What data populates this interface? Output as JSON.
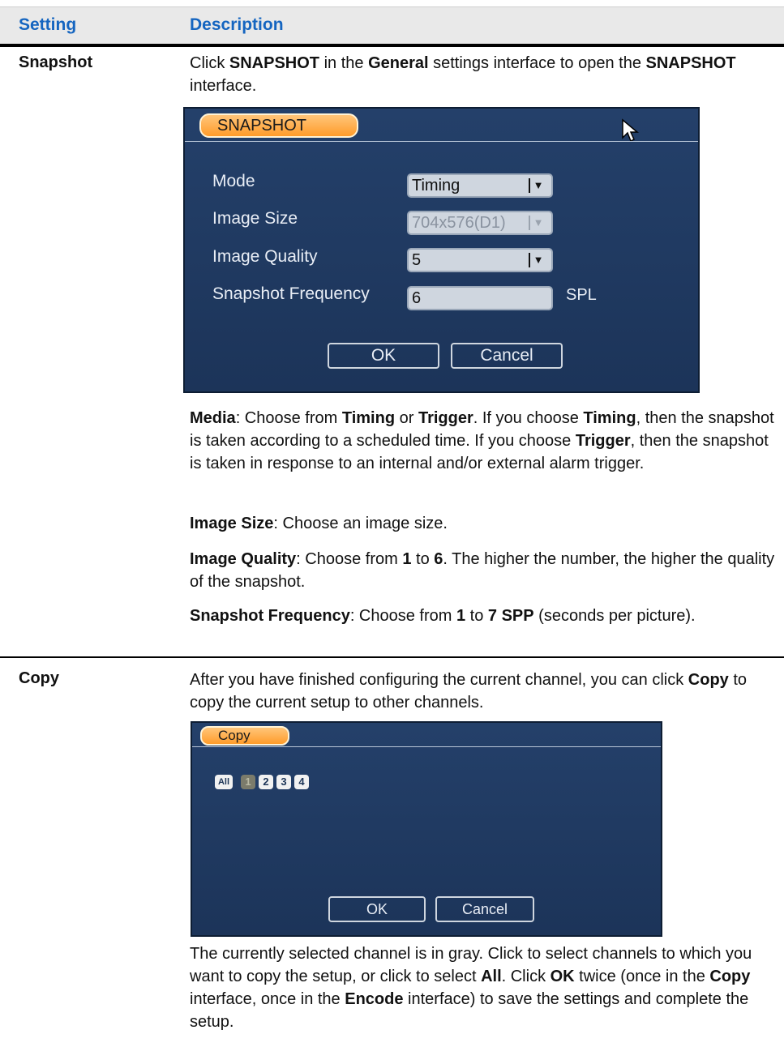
{
  "header": {
    "setting": "Setting",
    "description": "Description"
  },
  "snapshot": {
    "label": "Snapshot",
    "intro": [
      "Click ",
      "SNAPSHOT",
      " in the ",
      "General",
      " settings interface to open the ",
      "SNAPSHOT",
      " interface."
    ],
    "dialog": {
      "title": "SNAPSHOT",
      "mode_label": "Mode",
      "mode_value": "Timing",
      "size_label": "Image Size",
      "size_value": "704x576(D1)",
      "quality_label": "Image Quality",
      "quality_value": "5",
      "freq_label": "Snapshot Frequency",
      "freq_value": "6",
      "freq_unit": "SPL",
      "ok": "OK",
      "cancel": "Cancel"
    },
    "media": [
      "Media",
      ": Choose from ",
      "Timing",
      " or ",
      "Trigger",
      ". If you choose ",
      "Timing",
      ", then the snapshot is taken according to a scheduled time. If you choose ",
      "Trigger",
      ", then the snapshot is taken in response to an internal and/or external alarm trigger."
    ],
    "image_size": [
      "Image Size",
      ": Choose an image size."
    ],
    "image_quality": [
      "Image Quality",
      ": Choose from ",
      "1",
      " to ",
      "6",
      ". The higher the number, the higher the quality of the snapshot."
    ],
    "snapshot_frequency": [
      "Snapshot Frequency",
      ": Choose from ",
      "1",
      " to ",
      "7 SPP",
      " (seconds per picture)."
    ]
  },
  "copy": {
    "label": "Copy",
    "intro": [
      "After you have finished configuring the current channel, you can click ",
      "Copy",
      " to copy the current setup to other channels."
    ],
    "dialog": {
      "title": "Copy",
      "all": "All",
      "channels": [
        "1",
        "2",
        "3",
        "4"
      ],
      "selected_channel": "1",
      "ok": "OK",
      "cancel": "Cancel"
    },
    "outro": [
      "The currently selected channel is in gray. Click to select channels to which you want to copy the setup, or click to select ",
      "All",
      ". Click ",
      "OK",
      " twice (once in the ",
      "Copy",
      " interface, once in the ",
      "Encode",
      " interface) to save the settings and complete the setup."
    ]
  }
}
